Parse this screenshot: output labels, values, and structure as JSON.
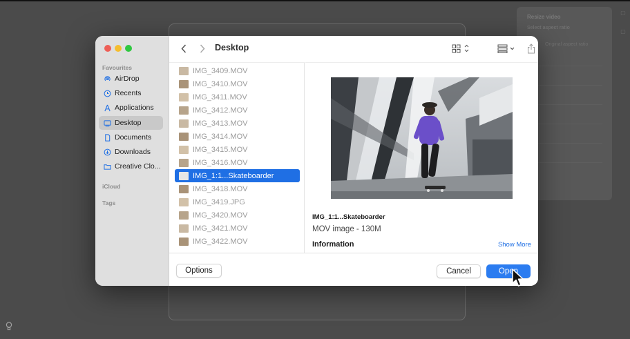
{
  "background_app": {
    "panel_title": "Resize video",
    "panel_subtitle": "Select aspect ratio",
    "panel_option": "Original aspect ratio"
  },
  "dialog": {
    "location_title": "Desktop",
    "sidebar": {
      "favourites_label": "Favourites",
      "items": [
        {
          "label": "AirDrop",
          "icon": "airdrop-icon"
        },
        {
          "label": "Recents",
          "icon": "clock-icon"
        },
        {
          "label": "Applications",
          "icon": "applications-icon"
        },
        {
          "label": "Desktop",
          "icon": "desktop-icon",
          "selected": true
        },
        {
          "label": "Documents",
          "icon": "document-icon"
        },
        {
          "label": "Downloads",
          "icon": "download-icon"
        },
        {
          "label": "Creative Clo...",
          "icon": "folder-icon"
        }
      ],
      "icloud_label": "iCloud",
      "tags_label": "Tags"
    },
    "files": [
      "IMG_3409.MOV",
      "IMG_3410.MOV",
      "IMG_3411.MOV",
      "IMG_3412.MOV",
      "IMG_3413.MOV",
      "IMG_3414.MOV",
      "IMG_3415.MOV",
      "IMG_3416.MOV",
      "IMG_1:1...Skateboarder",
      "IMG_3418.MOV",
      "IMG_3419.JPG",
      "IMG_3420.MOV",
      "IMG_3421.MOV",
      "IMG_3422.MOV"
    ],
    "selected_file_index": 8,
    "preview": {
      "name": "IMG_1:1...Skateboarder",
      "meta": "MOV image - 130M",
      "info_heading": "Information",
      "show_more": "Show More"
    },
    "buttons": {
      "options": "Options",
      "cancel": "Cancel",
      "open": "Open"
    },
    "colors": {
      "accent": "#1f6fe4",
      "traffic_close": "#ee5f57",
      "traffic_min": "#f5bd2f",
      "traffic_max": "#2fc840"
    }
  }
}
